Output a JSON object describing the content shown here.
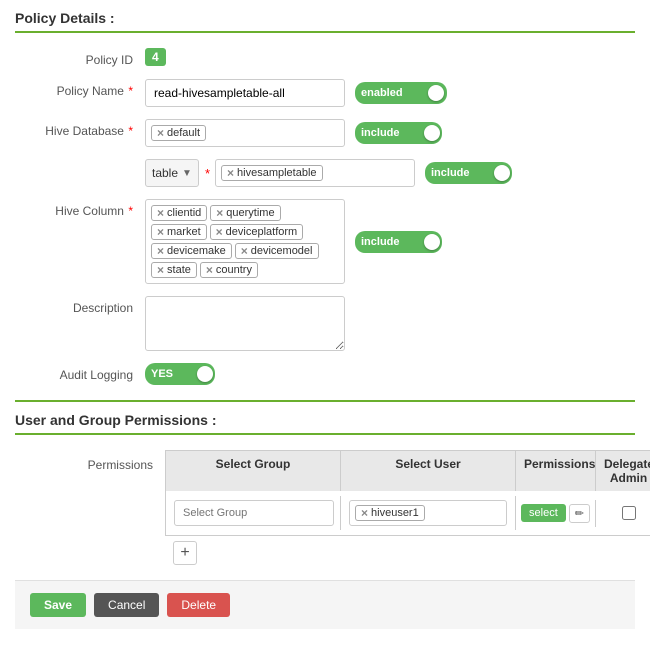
{
  "page": {
    "policy_details_title": "Policy Details :",
    "permissions_title": "User and Group Permissions :",
    "policy_id_label": "Policy ID",
    "policy_id_value": "4",
    "policy_name_label": "Policy Name",
    "policy_name_value": "read-hivesampletable-all",
    "enabled_label": "enabled",
    "hive_database_label": "Hive Database",
    "hive_database_tag": "default",
    "include_label_1": "include",
    "table_label": "table",
    "hive_table_tag": "hivesampletable",
    "include_label_2": "include",
    "hive_column_label": "Hive Column",
    "columns": [
      "clientid",
      "querytime",
      "market",
      "deviceplatform",
      "devicemake",
      "devicemodel",
      "state",
      "country"
    ],
    "include_label_3": "include",
    "description_label": "Description",
    "audit_logging_label": "Audit Logging",
    "audit_yes_label": "YES",
    "permissions_label": "Permissions",
    "select_group_header": "Select Group",
    "select_user_header": "Select User",
    "permissions_header": "Permissions",
    "delegate_admin_header": "Delegate Admin",
    "select_group_placeholder": "Select Group",
    "select_user_value": "hiveuser1",
    "select_btn_label": "select",
    "add_btn_label": "+",
    "save_btn": "Save",
    "cancel_btn": "Cancel",
    "delete_btn": "Delete"
  }
}
